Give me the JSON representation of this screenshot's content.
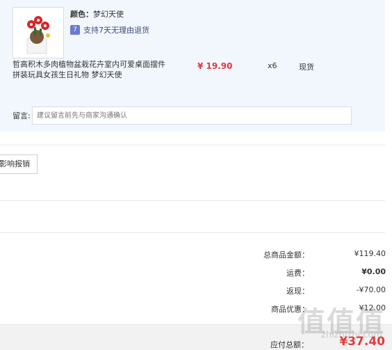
{
  "product": {
    "color_label": "颜色：",
    "color_value": "梦幻天使",
    "return_icon": "7",
    "return_policy": "支持7天无理由退货",
    "title": "哲高积木多肉植物盆栽花卉室内可爱桌面摆件拼装玩具女孩生日礼物 梦幻天使",
    "price": "¥ 19.90",
    "quantity": "x6",
    "stock_status": "现货"
  },
  "memo": {
    "label": "留言:",
    "placeholder": "建议留言前先与商家沟通确认"
  },
  "reimburse_button": "影响报销",
  "summary": {
    "items": [
      {
        "label": "总商品金额：",
        "value": "¥119.40"
      },
      {
        "label": "运费：",
        "value": "¥0.00"
      },
      {
        "label": "返现：",
        "value": "-¥70.00"
      },
      {
        "label": "商品优惠：",
        "value": "¥12.00"
      }
    ],
    "payable_label": "应付总额：",
    "payable_amount": "¥37.40"
  },
  "watermark": {
    "text": "值值值",
    "url": "zhizhizhi.com"
  },
  "colors": {
    "panel_bg": "#f2f7fd",
    "price_red": "#e4393c",
    "return_icon_bg": "#6a7bcf"
  }
}
